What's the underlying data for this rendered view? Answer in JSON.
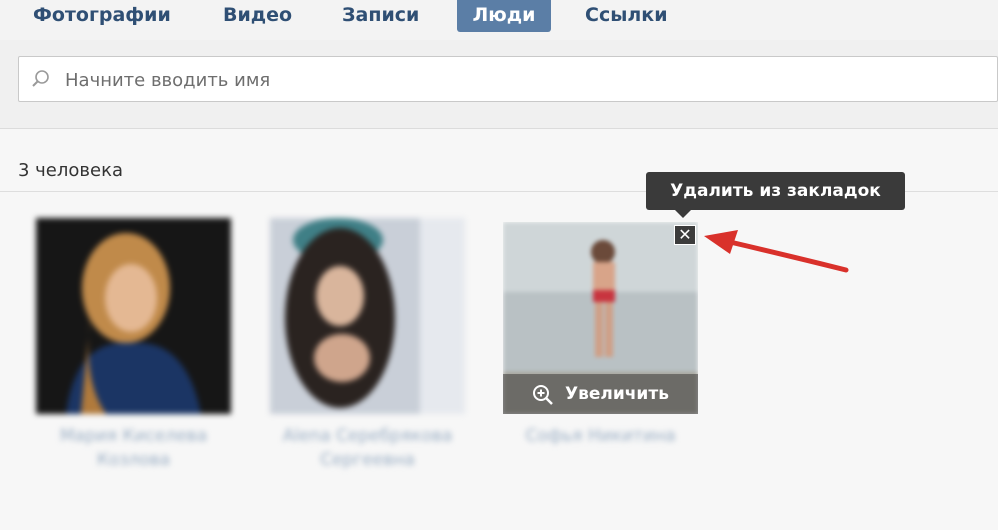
{
  "tabs": [
    {
      "label": "Фотографии",
      "active": false
    },
    {
      "label": "Видео",
      "active": false
    },
    {
      "label": "Записи",
      "active": false
    },
    {
      "label": "Люди",
      "active": true
    },
    {
      "label": "Ссылки",
      "active": false
    }
  ],
  "search": {
    "placeholder": "Начните вводить имя"
  },
  "results": {
    "count_label": "3 человека"
  },
  "people": [
    {
      "name_line1": "Мария Киселева",
      "name_line2": "Козлова"
    },
    {
      "name_line1": "Alena Серебрякова",
      "name_line2": "Сергеевна"
    },
    {
      "name_line1": "Софья Никитина",
      "name_line2": ""
    }
  ],
  "card_overlay": {
    "zoom_label": "Увеличить",
    "close_glyph": "✕"
  },
  "tooltip": {
    "text": "Удалить из закладок"
  },
  "colors": {
    "accent": "#5b7ea6",
    "tab_text": "#2f4f74",
    "arrow": "#d9312b"
  }
}
